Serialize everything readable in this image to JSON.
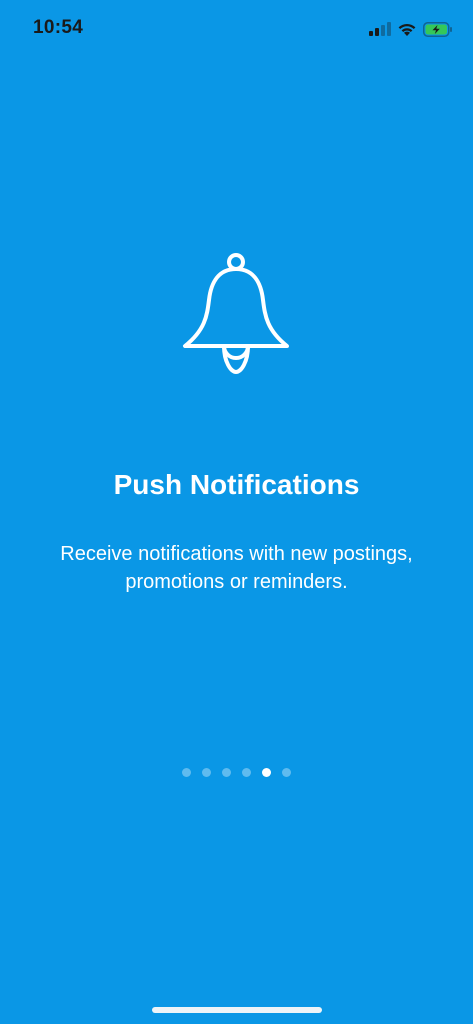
{
  "status_bar": {
    "time": "10:54",
    "signal_icon": "cellular-signal-icon",
    "wifi_icon": "wifi-icon",
    "battery_icon": "battery-charging-icon",
    "battery_color": "#34c759"
  },
  "onboarding": {
    "icon": "bell-icon",
    "title": "Push Notifications",
    "description": "Receive notifications with new postings, promotions or reminders.",
    "pager": {
      "total": 6,
      "active_index": 4
    }
  },
  "colors": {
    "background": "#0a97e6",
    "text": "#ffffff"
  }
}
